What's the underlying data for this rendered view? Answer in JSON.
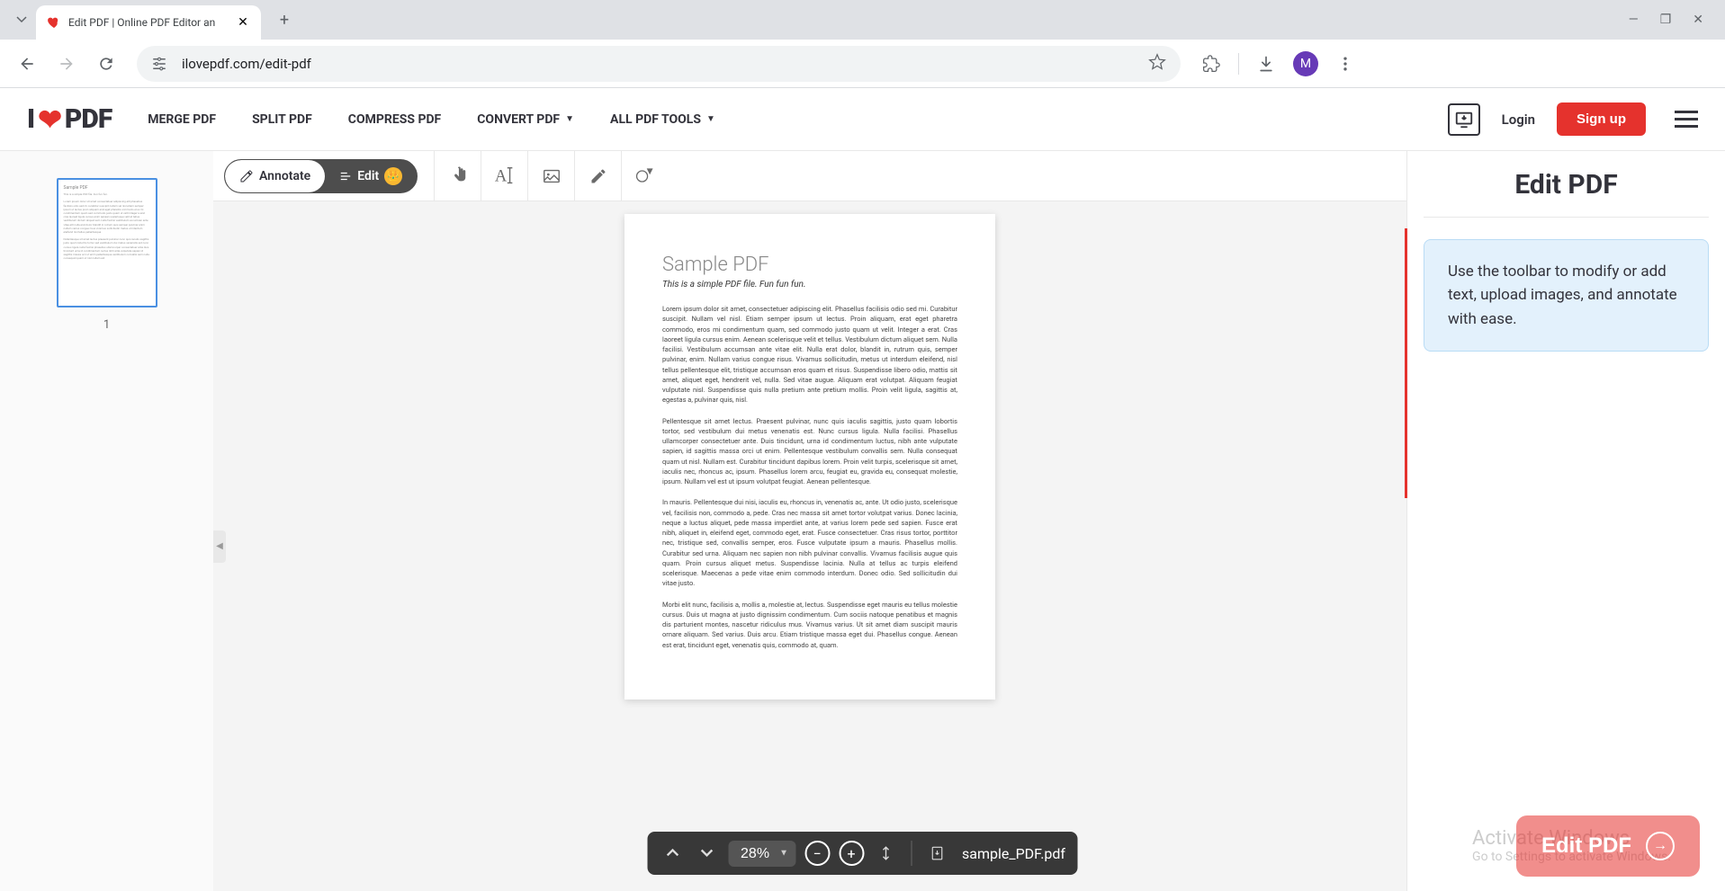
{
  "browser": {
    "tab_title": "Edit PDF | Online PDF Editor an",
    "url": "ilovepdf.com/edit-pdf",
    "profile_initial": "M"
  },
  "header": {
    "logo_prefix": "I",
    "logo_suffix": "PDF",
    "nav": {
      "merge": "MERGE PDF",
      "split": "SPLIT PDF",
      "compress": "COMPRESS PDF",
      "convert": "CONVERT PDF",
      "all_tools": "ALL PDF TOOLS"
    },
    "login": "Login",
    "signup": "Sign up"
  },
  "editor": {
    "mode": {
      "annotate": "Annotate",
      "edit": "Edit"
    },
    "thumb_label": "1"
  },
  "document": {
    "title": "Sample PDF",
    "subtitle": "This is a simple PDF file. Fun fun fun.",
    "para1": "Lorem ipsum dolor sit amet, consectetuer adipiscing elit. Phasellus facilisis odio sed mi. Curabitur suscipit. Nullam vel nisl. Etiam semper ipsum ut lectus. Proin aliquam, erat eget pharetra commodo, eros mi condimentum quam, sed commodo justo quam ut velit. Integer a erat. Cras laoreet ligula cursus enim. Aenean scelerisque velit et tellus. Vestibulum dictum aliquet sem. Nulla facilisi. Vestibulum accumsan ante vitae elit. Nulla erat dolor, blandit in, rutrum quis, semper pulvinar, enim. Nullam varius congue risus. Vivamus sollicitudin, metus ut interdum eleifend, nisl tellus pellentesque elit, tristique accumsan eros quam et risus. Suspendisse libero odio, mattis sit amet, aliquet eget, hendrerit vel, nulla. Sed vitae augue. Aliquam erat volutpat. Aliquam feugiat vulputate nisl. Suspendisse quis nulla pretium ante pretium mollis. Proin velit ligula, sagittis at, egestas a, pulvinar quis, nisl.",
    "para2": "Pellentesque sit amet lectus. Praesent pulvinar, nunc quis iaculis sagittis, justo quam lobortis tortor, sed vestibulum dui metus venenatis est. Nunc cursus ligula. Nulla facilisi. Phasellus ullamcorper consectetuer ante. Duis tincidunt, urna id condimentum luctus, nibh ante vulputate sapien, id sagittis massa orci ut enim. Pellentesque vestibulum convallis sem. Nulla consequat quam ut nisl. Nullam est. Curabitur tincidunt dapibus lorem. Proin velit turpis, scelerisque sit amet, iaculis nec, rhoncus ac, ipsum. Phasellus lorem arcu, feugiat eu, gravida eu, consequat molestie, ipsum. Nullam vel est ut ipsum volutpat feugiat. Aenean pellentesque.",
    "para3": "In mauris. Pellentesque dui nisi, iaculis eu, rhoncus in, venenatis ac, ante. Ut odio justo, scelerisque vel, facilisis non, commodo a, pede. Cras nec massa sit amet tortor volutpat varius. Donec lacinia, neque a luctus aliquet, pede massa imperdiet ante, at varius lorem pede sed sapien. Fusce erat nibh, aliquet in, eleifend eget, commodo eget, erat. Fusce consectetuer. Cras risus tortor, porttitor nec, tristique sed, convallis semper, eros. Fusce vulputate ipsum a mauris. Phasellus mollis. Curabitur sed urna. Aliquam nec sapien non nibh pulvinar convallis. Vivamus facilisis augue quis quam. Proin cursus aliquet metus. Suspendisse lacinia. Nulla at tellus ac turpis eleifend scelerisque. Maecenas a pede vitae enim commodo interdum. Donec odio. Sed sollicitudin dui vitae justo.",
    "para4": "Morbi elit nunc, facilisis a, mollis a, molestie at, lectus. Suspendisse eget mauris eu tellus molestie cursus. Duis ut magna at justo dignissim condimentum. Cum sociis natoque penatibus et magnis dis parturient montes, nascetur ridiculus mus. Vivamus varius. Ut sit amet diam suscipit mauris ornare aliquam. Sed varius. Duis arcu. Etiam tristique massa eget dui. Phasellus congue. Aenean est erat, tincidunt eget, venenatis quis, commodo at, quam."
  },
  "right_panel": {
    "title": "Edit PDF",
    "info": "Use the toolbar to modify or add text, upload images, and annotate with ease."
  },
  "bottom_bar": {
    "zoom": "28%",
    "filename": "sample_PDF.pdf"
  },
  "fab": {
    "label": "Edit PDF"
  },
  "watermark": {
    "title": "Activate Windows",
    "sub": "Go to Settings to activate Windows."
  }
}
